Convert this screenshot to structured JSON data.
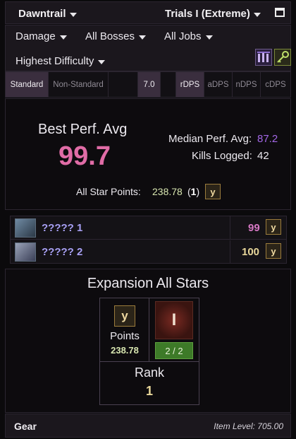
{
  "header": {
    "expansion": "Dawntrail",
    "category": "Trials I (Extreme)"
  },
  "filters": {
    "metric": "Damage",
    "bosses": "All Bosses",
    "jobs": "All Jobs",
    "difficulty": "Highest Difficulty"
  },
  "tabs": {
    "standard": "Standard",
    "non_standard": "Non-Standard",
    "patch": "7.0",
    "rdps": "rDPS",
    "adps": "aDPS",
    "ndps": "nDPS",
    "cdps": "cDPS"
  },
  "perf": {
    "best_label": "Best Perf. Avg",
    "best_value": "99.7",
    "median_label": "Median Perf. Avg:",
    "median_value": "87.2",
    "kills_label": "Kills Logged:",
    "kills_value": "42",
    "allstar_label": "All Star Points:",
    "allstar_value": "238.78",
    "allstar_rank_open": "(",
    "allstar_rank": "1",
    "allstar_rank_close": ")"
  },
  "bosses": [
    {
      "name": "????? 1",
      "score": "99",
      "color": "#d678c4"
    },
    {
      "name": "????? 2",
      "score": "100",
      "color": "#e8d79a"
    }
  ],
  "allstars": {
    "title": "Expansion All Stars",
    "points_label": "Points",
    "points_value": "238.78",
    "crest_glyph": "I",
    "kills": "2 / 2",
    "rank_label": "Rank",
    "rank_value": "1"
  },
  "gear": {
    "title": "Gear",
    "item_level": "Item Level: 705.00"
  },
  "icons": {
    "star_button": "y"
  },
  "colors": {
    "accent_pink": "#e06ca6",
    "accent_purple": "#a367e6",
    "gold": "#e8d79a",
    "green": "#3d7a28"
  }
}
